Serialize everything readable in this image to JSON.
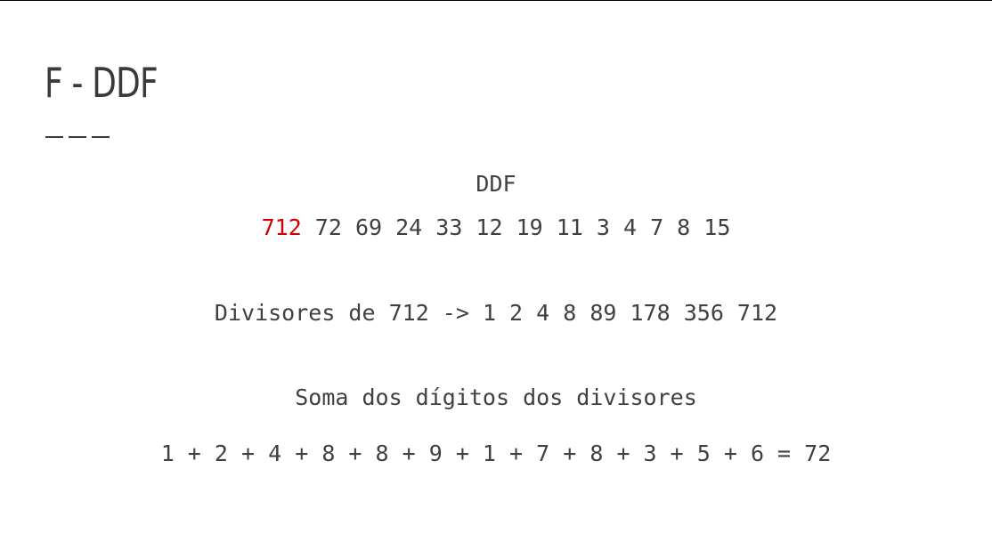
{
  "slide": {
    "title": "F - DDF"
  },
  "content": {
    "heading": "DDF",
    "sequence_highlight": "712",
    "sequence_rest": " 72 69 24 33 12 19 11 3 4 7 8 15",
    "divisors_line": "Divisores de 712 -> 1 2 4 8 89 178 356 712",
    "sum_heading": "Soma dos dígitos dos divisores",
    "sum_line": "1 + 2 + 4 + 8 + 8 + 9 + 1 + 7 + 8 + 3 + 5 + 6 = 72"
  },
  "colors": {
    "highlight": "#d40000",
    "text": "#404040"
  }
}
